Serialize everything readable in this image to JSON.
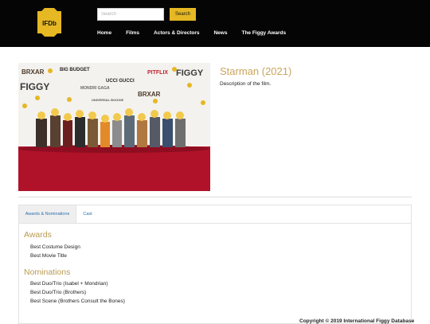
{
  "site": {
    "logo_text": "IFDb"
  },
  "search": {
    "placeholder": "Search",
    "button_label": "Search"
  },
  "nav": {
    "items": [
      "Home",
      "Films",
      "Actors & Directors",
      "News",
      "The Figgy Awards"
    ]
  },
  "film": {
    "title": "Starman (2021)",
    "description": "Description of the film."
  },
  "poster": {
    "backdrop_text": [
      "BRXAR",
      "BIG BUDGET",
      "FIGGY",
      "UCCI GUCCI",
      "PITFLIX",
      "MONDRI GAGA",
      "UNIVERSAL BOOGIE",
      "BRXAR",
      "FIGGY"
    ]
  },
  "tabs": [
    {
      "label": "Awards & Nominations",
      "active": true
    },
    {
      "label": "Cast",
      "active": false
    }
  ],
  "awards": {
    "heading": "Awards",
    "items": [
      "Best Costume Design",
      "Best Movie Title"
    ]
  },
  "nominations": {
    "heading": "Nominations",
    "items": [
      "Best Duo/Trio (Isabel + Mondrian)",
      "Best Duo/Trio (Brothers)",
      "Best Scene (Brothers Consult the Bones)"
    ]
  },
  "footer": {
    "copyright": "Copyright © 2019 International Figgy Database"
  },
  "colors": {
    "header_bg": "#050505",
    "accent_gold": "#e5b824",
    "title_gold": "#c9a55c",
    "link_blue": "#2a6fb0",
    "carpet_red": "#b0122a"
  }
}
